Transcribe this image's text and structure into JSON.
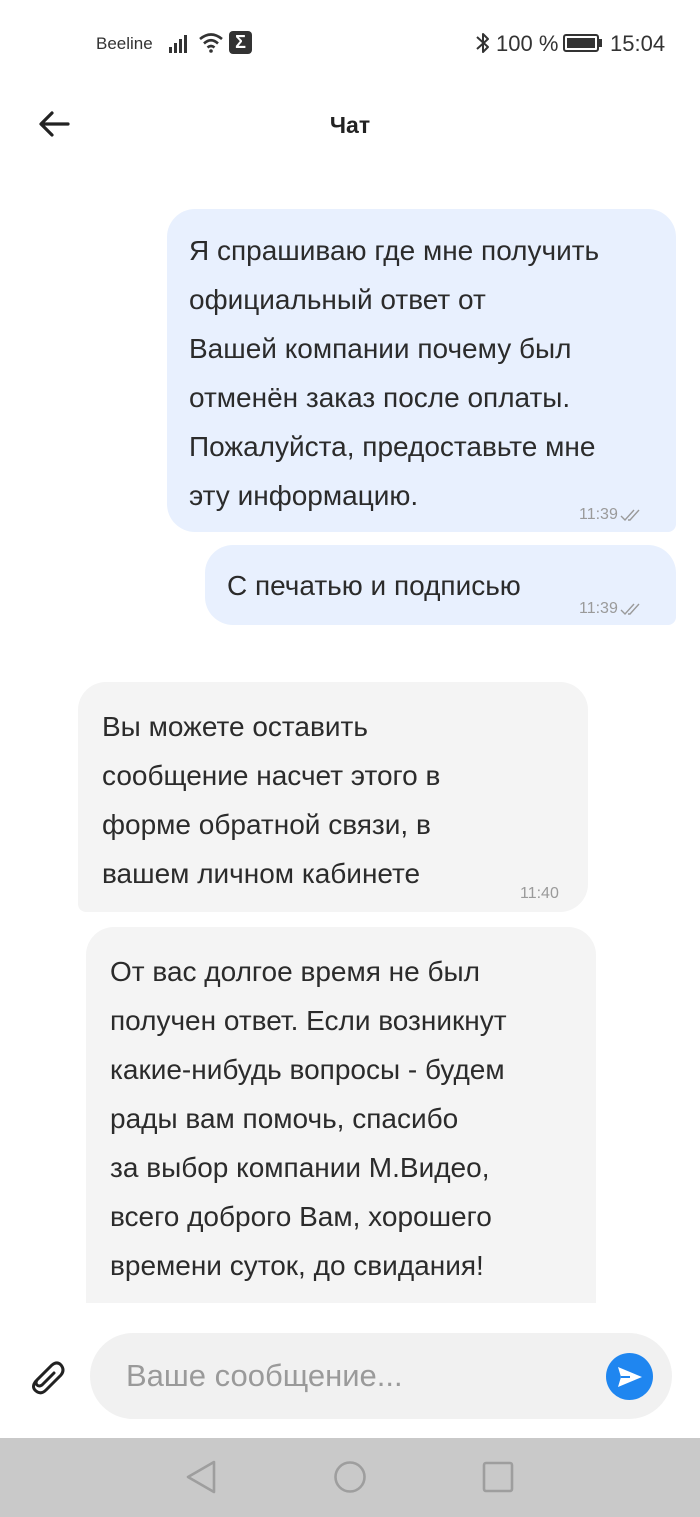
{
  "status_bar": {
    "carrier": "Beeline",
    "battery_percent": "100 %",
    "time": "15:04",
    "icons": [
      "signal-icon",
      "wifi-icon",
      "sigma-icon",
      "bluetooth-icon",
      "battery-icon"
    ]
  },
  "header": {
    "title": "Чат",
    "back_icon": "arrow-left-icon"
  },
  "messages": [
    {
      "direction": "outgoing",
      "text": "Я спрашиваю где мне получить\nофициальный ответ от\nВашей компании почему был\nотменён заказ после оплаты.\nПожалуйста, предоставьте мне\nэту информацию.",
      "time": "11:39",
      "status": "read"
    },
    {
      "direction": "outgoing",
      "text": "С печатью и подписью",
      "time": "11:39",
      "status": "read"
    },
    {
      "direction": "incoming",
      "text": "Вы можете оставить\nсообщение насчет этого в\nформе обратной связи, в\nвашем личном кабинете",
      "time": "11:40"
    },
    {
      "direction": "incoming",
      "text": "От вас долгое время не был\nполучен ответ. Если возникнут\nкакие-нибудь вопросы - будем\nрады вам помочь, спасибо\nза выбор компании М.Видео,\nвсего доброго Вам, хорошего\nвремени суток, до свидания!"
    }
  ],
  "composer": {
    "placeholder": "Ваше сообщение...",
    "value": "",
    "attach_icon": "paperclip-icon",
    "send_icon": "send-icon"
  },
  "colors": {
    "outgoing_bubble": "#e8f0fe",
    "incoming_bubble": "#f4f4f4",
    "send_button": "#1f86f0",
    "nav_bar": "#c9c9c9"
  }
}
